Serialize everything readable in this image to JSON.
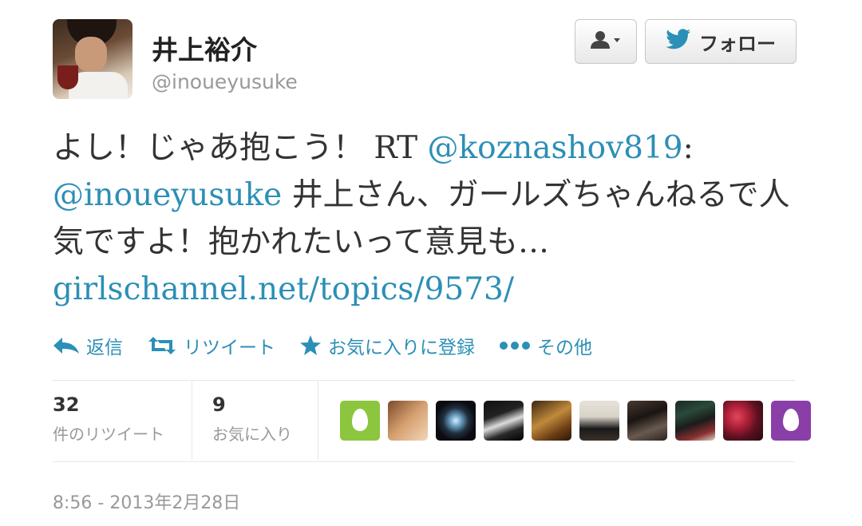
{
  "header": {
    "display_name": "井上裕介",
    "screen_name": "@inoueyusuke",
    "follow_label": "フォロー",
    "user_dropdown_icon": "user-dropdown-icon",
    "follow_icon": "twitter-bird-icon"
  },
  "tweet": {
    "text_1": "よし！じゃあ抱こう！ RT ",
    "mention_1": "@koznashov819",
    "text_2": ": ",
    "mention_2": "@inoueyusuke",
    "text_3": " 井上さん、ガールズちゃんねるで人気ですよ！抱かれたいって意見も…",
    "link": "girlschannel.net/topics/9573/"
  },
  "actions": {
    "reply": "返信",
    "retweet": "リツイート",
    "favorite": "お気に入りに登録",
    "more": "その他"
  },
  "stats": {
    "retweets_count": "32",
    "retweets_label": "件のリツイート",
    "favorites_count": "9",
    "favorites_label": "お気に入り"
  },
  "timestamp": "8:56 - 2013年2月28日",
  "colors": {
    "link": "#2c8fb6",
    "muted": "#999999",
    "text": "#333333"
  }
}
